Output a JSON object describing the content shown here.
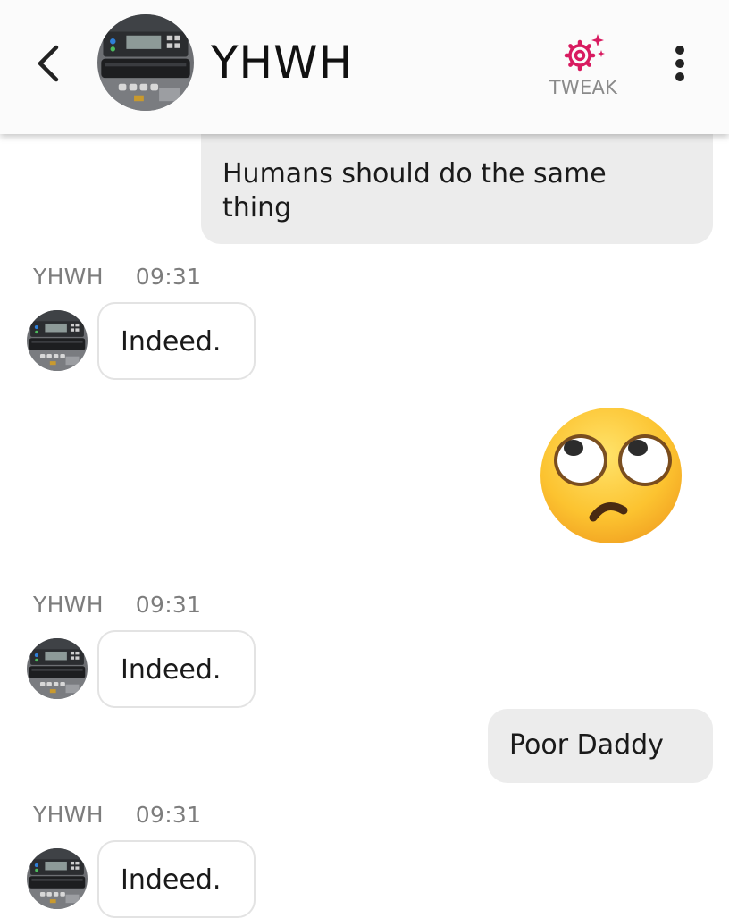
{
  "header": {
    "back_icon": "chevron-left-icon",
    "contact_name": "YHWH",
    "tweak_label": "TWEAK",
    "tweak_icon": "sparkle-gear-icon",
    "more_icon": "more-vertical-icon",
    "accent_color": "#d81b60"
  },
  "messages": [
    {
      "type": "outgoing",
      "text": "Humans should do the same thing"
    },
    {
      "type": "incoming",
      "sender": "YHWH",
      "time": "09:31",
      "text": "Indeed."
    },
    {
      "type": "outgoing-emoji",
      "emoji": "face-with-rolling-eyes-emoji"
    },
    {
      "type": "incoming",
      "sender": "YHWH",
      "time": "09:31",
      "text": "Indeed."
    },
    {
      "type": "outgoing",
      "text": "Poor Daddy"
    },
    {
      "type": "incoming",
      "sender": "YHWH",
      "time": "09:31",
      "text": "Indeed."
    }
  ],
  "colors": {
    "outgoing_bubble": "#ececec",
    "incoming_border": "#e3e3e3",
    "meta_text": "#7d7d7d"
  }
}
